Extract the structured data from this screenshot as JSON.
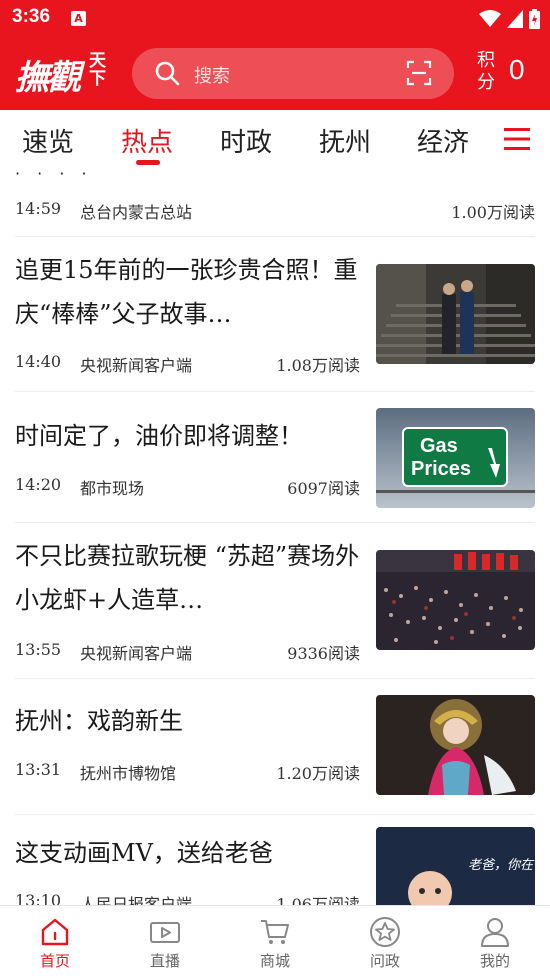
{
  "status": {
    "time": "3:36",
    "notif": "A"
  },
  "header": {
    "logo_main": "撫觀",
    "logo_side": "天下",
    "search_placeholder": "搜索",
    "points_label": "积分",
    "points_value": "0"
  },
  "tabs": [
    {
      "label": "速览"
    },
    {
      "label": "热点",
      "active": true
    },
    {
      "label": "时政"
    },
    {
      "label": "抚州"
    },
    {
      "label": "经济"
    }
  ],
  "feed": {
    "partial": {
      "time": "14:59",
      "source": "总台内蒙古总站",
      "reads": "1.00万阅读"
    },
    "items": [
      {
        "title": "追更15年前的一张珍贵合照！重庆“棒棒”父子故事…",
        "time": "14:40",
        "source": "央视新闻客户端",
        "reads": "1.08万阅读",
        "thumb": "stairs-photo"
      },
      {
        "title": "时间定了，油价即将调整！",
        "time": "14:20",
        "source": "都市现场",
        "reads": "6097阅读",
        "thumb": "gas-prices-sign",
        "sign_line1": "Gas",
        "sign_line2": "Prices"
      },
      {
        "title": "不只比赛拉歌玩梗 “苏超”赛场外小龙虾+人造草…",
        "time": "13:55",
        "source": "央视新闻客户端",
        "reads": "9336阅读",
        "thumb": "stadium-crowd"
      },
      {
        "title": "抚州：戏韵新生",
        "time": "13:31",
        "source": "抚州市博物馆",
        "reads": "1.20万阅读",
        "thumb": "opera-performer"
      },
      {
        "title": "这支动画MV，送给老爸",
        "time": "13:10",
        "source": "人民日报客户端",
        "reads": "1.06万阅读",
        "thumb": "animation-still",
        "thumb_text": "老爸，你在干嘛"
      }
    ]
  },
  "bottom_nav": [
    {
      "label": "首页",
      "icon": "home-icon",
      "active": true
    },
    {
      "label": "直播",
      "icon": "live-icon"
    },
    {
      "label": "商城",
      "icon": "cart-icon"
    },
    {
      "label": "问政",
      "icon": "star-icon"
    },
    {
      "label": "我的",
      "icon": "profile-icon"
    }
  ],
  "colors": {
    "brand": "#e8141e"
  }
}
